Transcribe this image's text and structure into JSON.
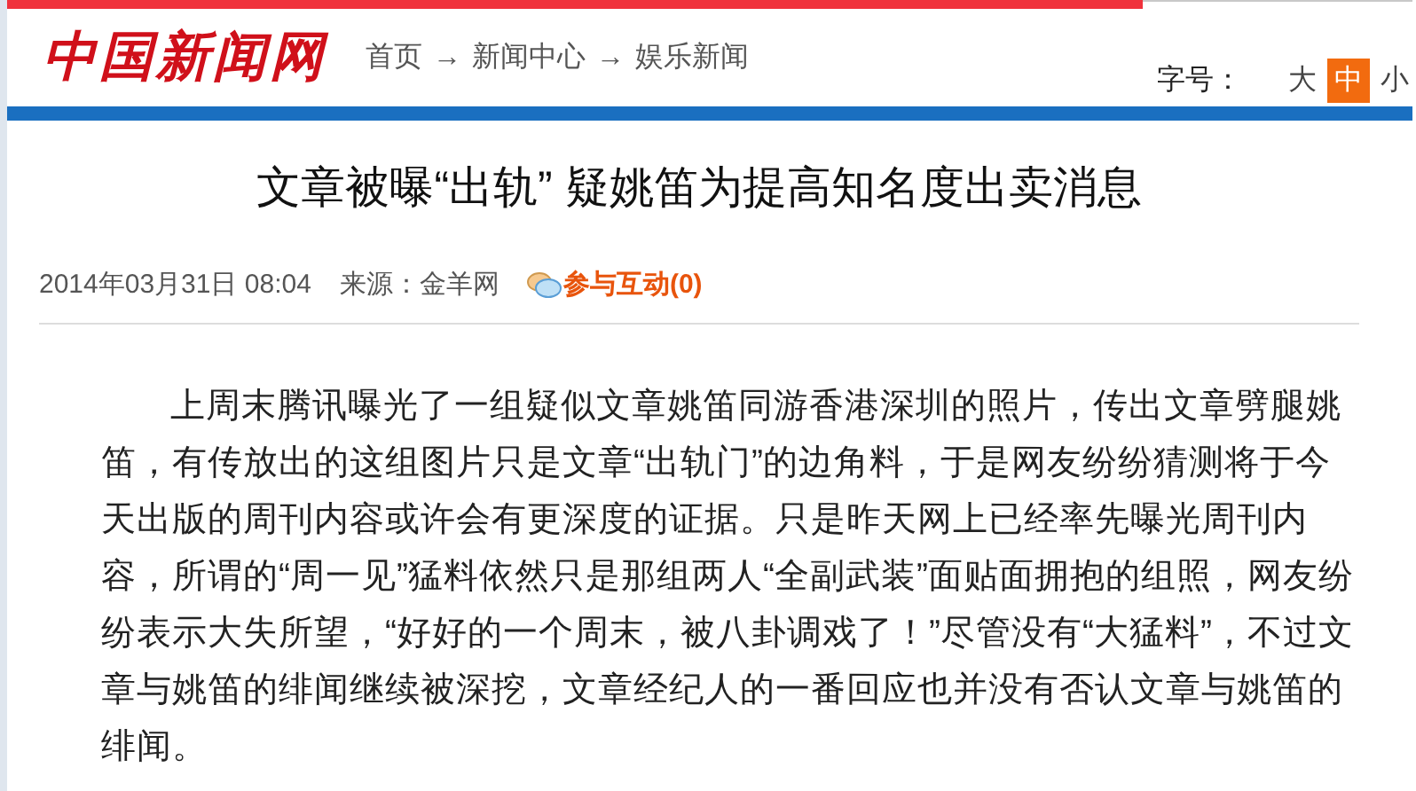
{
  "header": {
    "logo": "中国新闻网",
    "breadcrumb": [
      "首页",
      "新闻中心",
      "娱乐新闻"
    ],
    "separator": "→",
    "font_size_label": "字号：",
    "font_sizes": [
      {
        "label": "大",
        "selected": false
      },
      {
        "label": "中",
        "selected": true
      },
      {
        "label": "小",
        "selected": false
      }
    ]
  },
  "article": {
    "title": "文章被曝“出轨” 疑姚笛为提高知名度出卖消息",
    "date": "2014年03月31日 08:04",
    "source": "来源：金羊网",
    "comments": "参与互动(0)",
    "body": "上周末腾讯曝光了一组疑似文章姚笛同游香港深圳的照片，传出文章劈腿姚笛，有传放出的这组图片只是文章“出轨门”的边角料，于是网友纷纷猜测将于今天出版的周刊内容或许会有更深度的证据。只是昨天网上已经率先曝光周刊内容，所谓的“周一见”猛料依然只是那组两人“全副武装”面贴面拥抱的组照，网友纷纷表示大失所望，“好好的一个周末，被八卦调戏了！”尽管没有“大猛料”，不过文章与姚笛的绯闻继续被深挖，文章经纪人的一番回应也并没有否认文章与姚笛的绯闻。"
  }
}
